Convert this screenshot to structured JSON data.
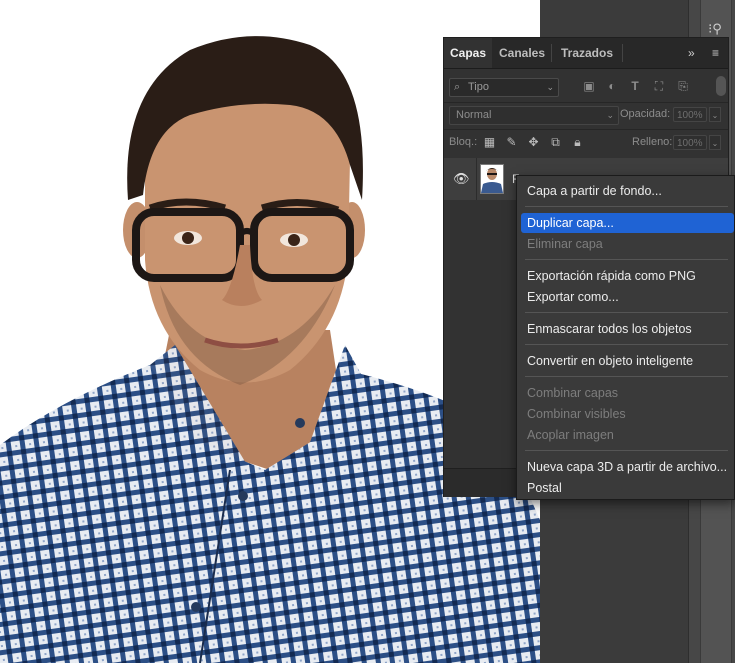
{
  "panel": {
    "tabs": [
      {
        "label": "Capas"
      },
      {
        "label": "Canales"
      },
      {
        "label": "Trazados"
      }
    ],
    "expand_glyph": "»",
    "menu_glyph": "≡",
    "filter": {
      "placeholder": "Tipo"
    },
    "blend_mode": "Normal",
    "opacity_label": "Opacidad:",
    "opacity_value": "100%",
    "lock_label": "Bloq.:",
    "fill_label": "Relleno:",
    "fill_value": "100%",
    "layer": {
      "name": "F"
    }
  },
  "context_menu": {
    "items": [
      {
        "label": "Capa a partir de fondo...",
        "enabled": true
      },
      {
        "label": "Duplicar capa...",
        "enabled": true,
        "highlighted": true
      },
      {
        "label": "Eliminar capa",
        "enabled": false
      },
      {
        "label": "Exportación rápida como PNG",
        "enabled": true
      },
      {
        "label": "Exportar como...",
        "enabled": true
      },
      {
        "label": "Enmascarar todos los objetos",
        "enabled": true
      },
      {
        "label": "Convertir en objeto inteligente",
        "enabled": true
      },
      {
        "label": "Combinar capas",
        "enabled": false
      },
      {
        "label": "Combinar visibles",
        "enabled": false
      },
      {
        "label": "Acoplar imagen",
        "enabled": false
      },
      {
        "label": "Nueva capa 3D a partir de archivo...",
        "enabled": true
      },
      {
        "label": "Postal",
        "enabled": true
      }
    ]
  },
  "icons": {
    "search": "search-icon",
    "pixel_filter": "image-filter-icon",
    "adjustment_filter": "adjustment-filter-icon",
    "type_filter": "type-filter-icon",
    "shape_filter": "shape-filter-icon",
    "smart_filter": "smart-object-filter-icon",
    "lock_pixels": "lock-transparent-icon",
    "lock_paint": "brush-icon",
    "lock_position": "move-icon",
    "lock_artboard": "artboard-icon",
    "lock_all": "lock-icon",
    "visibility": "eye-icon"
  },
  "colors": {
    "highlight": "#1f63d4",
    "panel_bg": "#323232",
    "menu_bg": "#3a3a3a"
  }
}
